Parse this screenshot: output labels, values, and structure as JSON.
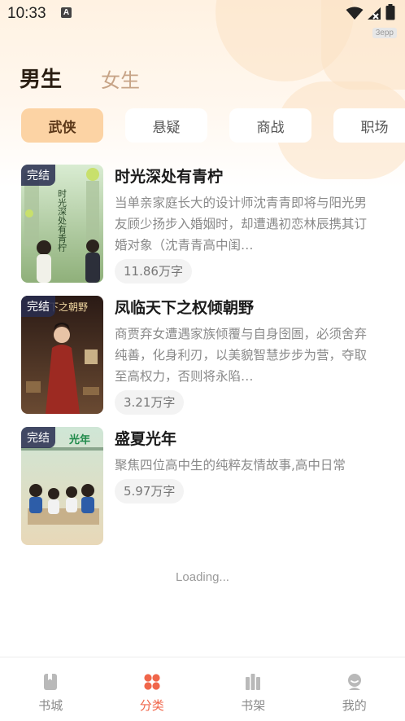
{
  "status_bar": {
    "time": "10:33",
    "notification_glyph": "A",
    "corner_badge": "3epp"
  },
  "gender_tabs": [
    {
      "label": "男生",
      "active": true
    },
    {
      "label": "女生",
      "active": false
    }
  ],
  "category_chips": [
    {
      "label": "武侠",
      "active": true
    },
    {
      "label": "悬疑",
      "active": false
    },
    {
      "label": "商战",
      "active": false
    },
    {
      "label": "职场",
      "active": false
    }
  ],
  "books": [
    {
      "badge": "完结",
      "title": "时光深处有青柠",
      "description": "当单亲家庭长大的设计师沈青青即将与阳光男友顾少扬步入婚姻时，却遭遇初恋林辰携其订婚对象（沈青青高中闺…",
      "word_count": "11.86万字",
      "cover_text": "时光深处有青柠"
    },
    {
      "badge": "完结",
      "title": "凤临天下之权倾朝野",
      "description": "商贾弃女遭遇家族倾覆与自身囹圄，必须舍弃纯善，化身利刃，以美貌智慧步步为营，夺取至高权力，否则将永陷…",
      "word_count": "3.21万字",
      "cover_text": "天下之朝野"
    },
    {
      "badge": "完结",
      "title": "盛夏光年",
      "description": "聚焦四位高中生的纯粹友情故事,高中日常",
      "word_count": "5.97万字",
      "cover_text": "光年"
    }
  ],
  "loading_text": "Loading...",
  "bottom_nav": [
    {
      "label": "书城",
      "icon": "book-city-icon",
      "active": false
    },
    {
      "label": "分类",
      "icon": "category-icon",
      "active": true
    },
    {
      "label": "书架",
      "icon": "bookshelf-icon",
      "active": false
    },
    {
      "label": "我的",
      "icon": "profile-icon",
      "active": false
    }
  ],
  "colors": {
    "accent": "#f0664a",
    "chip_active_bg": "#fcd3a4",
    "header_bg": "#fff2e2"
  }
}
